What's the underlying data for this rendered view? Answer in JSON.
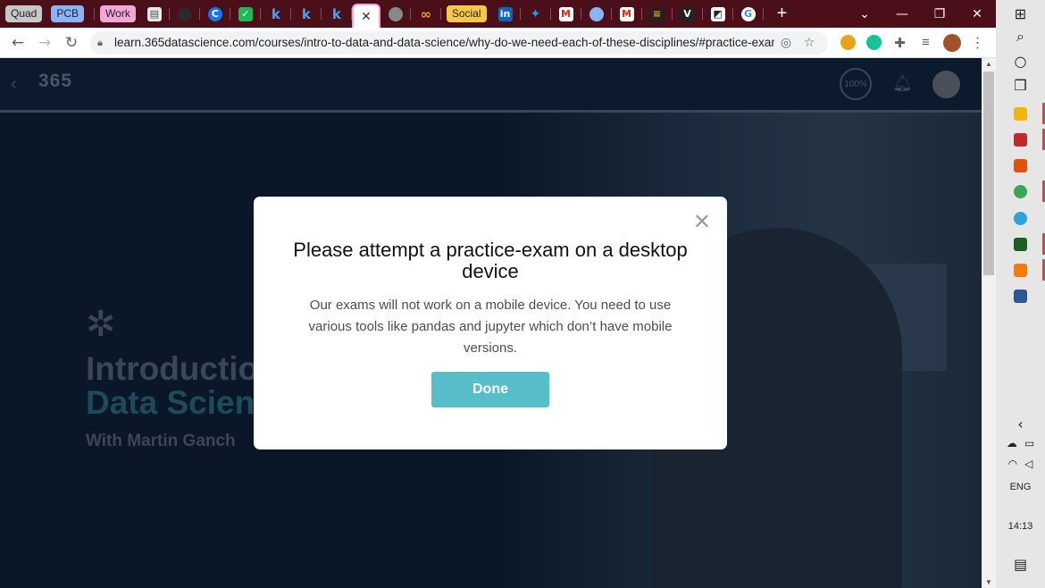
{
  "browser": {
    "tab_groups": [
      {
        "label": "Quad",
        "color": "#c8c8c8"
      },
      {
        "label": "PCB",
        "color": "#8ab4f8"
      },
      {
        "label": "Work",
        "color": "#f4a7d6"
      },
      {
        "label": "Social",
        "color": "#f7c948"
      }
    ],
    "active_tab_close": "✕",
    "new_tab": "+",
    "url": "learn.365datascience.com/courses/intro-to-data-and-data-science/why-do-we-need-each-of-these-disciplines/#practice-exam",
    "window_controls": {
      "collapse": "⌄",
      "minimize": "—",
      "restore": "❐",
      "close": "✕"
    }
  },
  "site_header": {
    "logo": "365",
    "progress": "100%"
  },
  "course": {
    "title_line1": "Introductio",
    "title_line2": "Data Scien",
    "author": "With Martin Ganch"
  },
  "modal": {
    "title": "Please attempt a practice-exam on a desktop device",
    "body": "Our exams will not work on a mobile device. You need to use various tools like pandas and jupyter which don’t have mobile versions.",
    "button": "Done",
    "close_icon": "✕"
  },
  "taskbar": {
    "language": "ENG",
    "time": "14:13"
  },
  "colors": {
    "modal_button": "#57bdc8",
    "tab_strip": "#4b0f1a",
    "page_bg": "#0a1728"
  }
}
